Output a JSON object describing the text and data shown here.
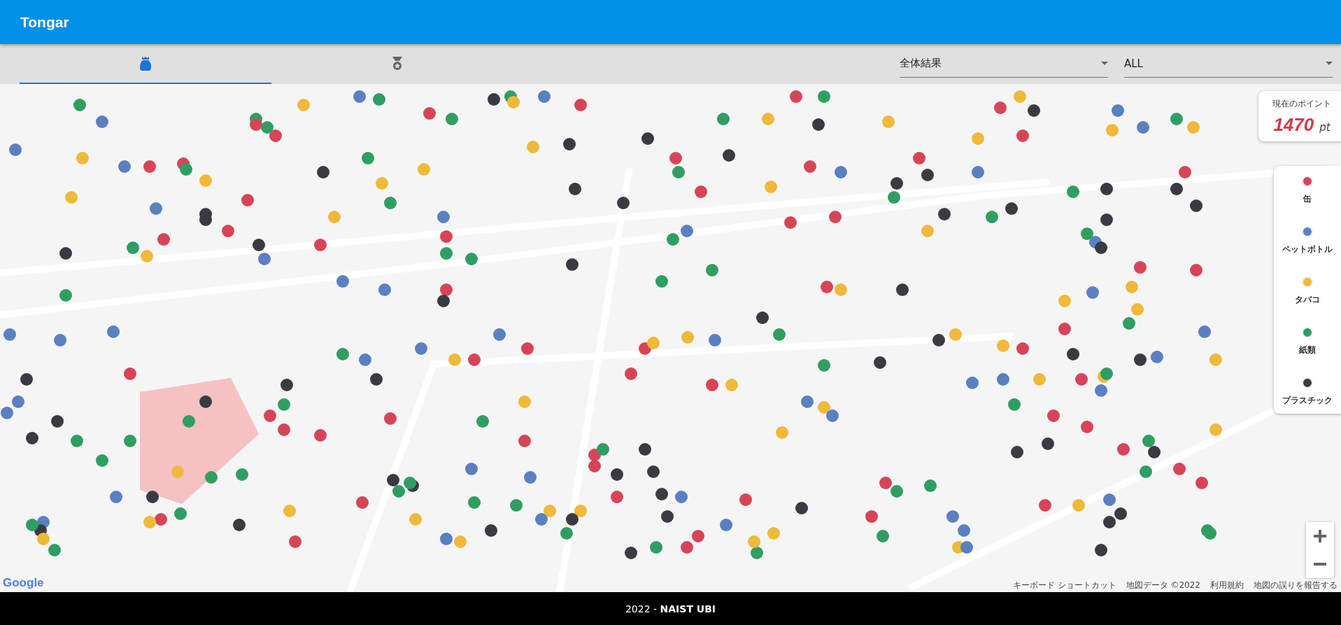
{
  "app_bar": {
    "title": "Tongar"
  },
  "tabs": [
    {
      "kind": "bag",
      "selected": true
    },
    {
      "kind": "medal",
      "selected": false
    }
  ],
  "filters": [
    {
      "value": "全体結果"
    },
    {
      "value": "ALL"
    }
  ],
  "points_card": {
    "label": "現在のポイント",
    "value": "1470",
    "unit": "pt"
  },
  "legend": [
    {
      "label": "缶",
      "color": "#d84457"
    },
    {
      "label": "ペットボトル",
      "color": "#5a80c2"
    },
    {
      "label": "タバコ",
      "color": "#f0b93a"
    },
    {
      "label": "紙類",
      "color": "#2f9e62"
    },
    {
      "label": "プラスチック",
      "color": "#3a3b42"
    }
  ],
  "map": {
    "logo": "Google",
    "attribution": [
      "キーボード ショートカット",
      "地図データ ©2022",
      "利用規約",
      "地図の誤りを報告する"
    ]
  },
  "footer": "2022 - **NAIST UBI**"
}
